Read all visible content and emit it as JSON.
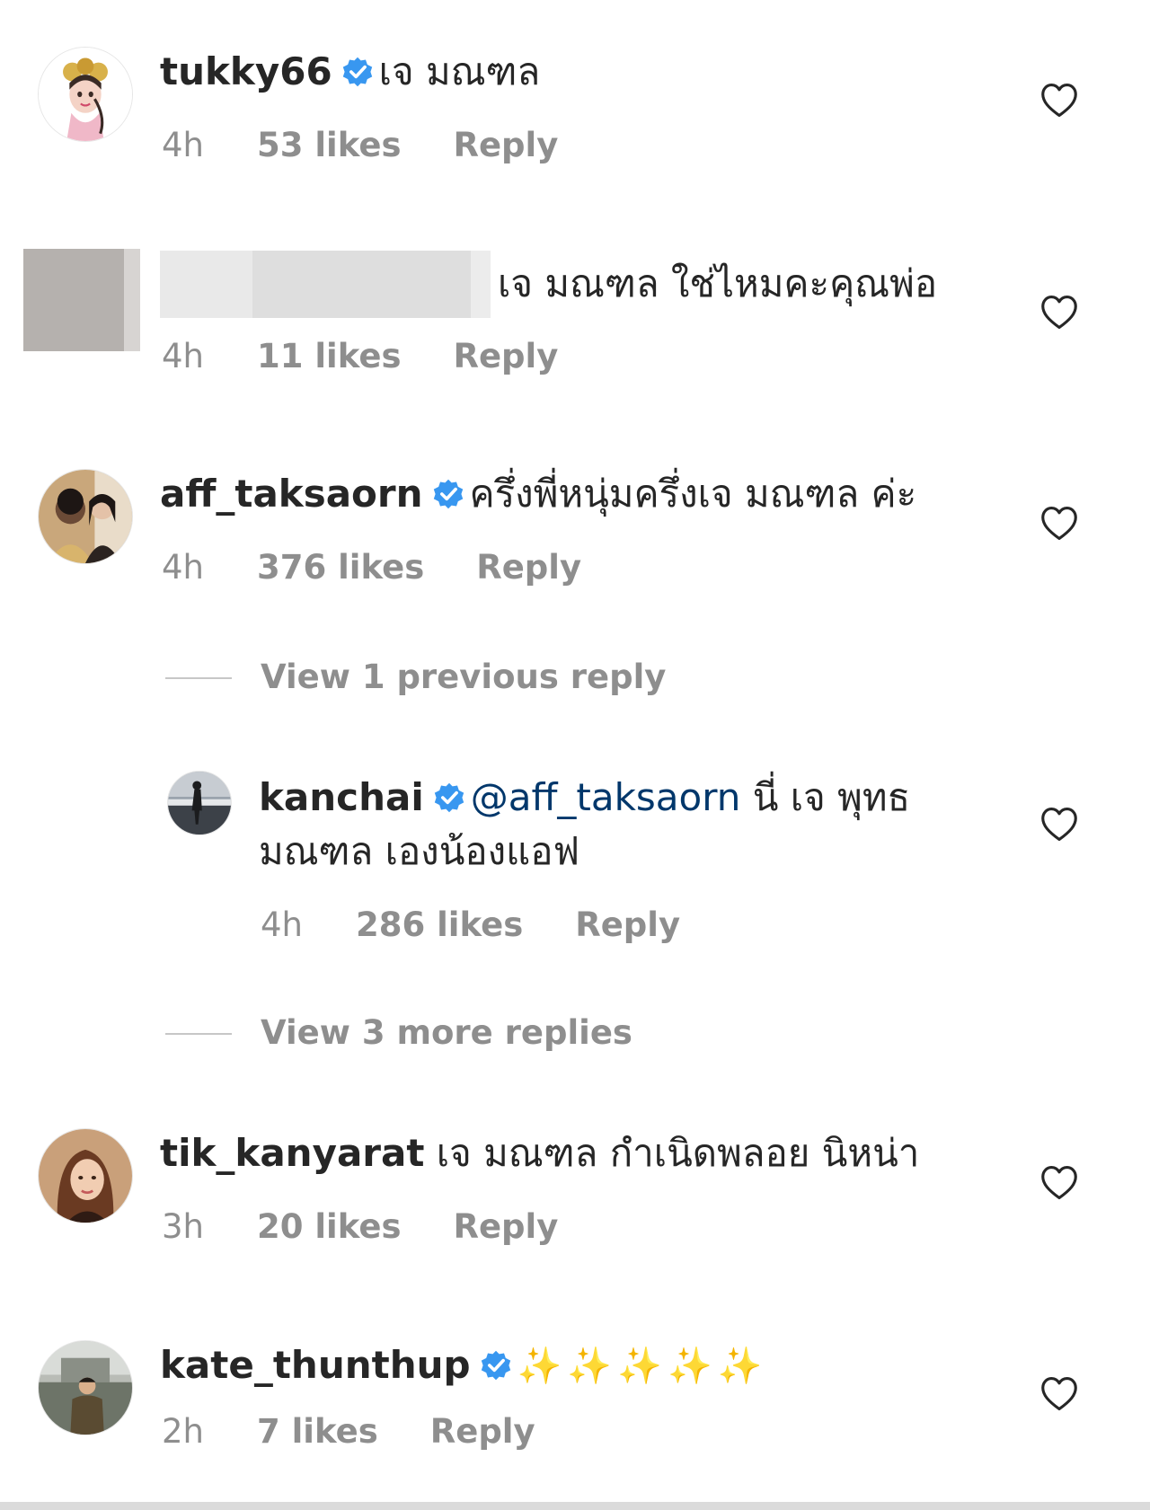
{
  "comments": [
    {
      "username": "tukky66",
      "verified": true,
      "text": "เจ มณฑล",
      "time": "4h",
      "likes": "53 likes",
      "reply": "Reply"
    },
    {
      "username": "",
      "verified": false,
      "text": "เจ มณฑล ใช่ไหมคะคุณพ่อ",
      "time": "4h",
      "likes": "11 likes",
      "reply": "Reply"
    },
    {
      "username": "aff_taksaorn",
      "verified": true,
      "text": "ครึ่งพี่หนุ่มครึ่งเจ มณฑล ค่ะ",
      "time": "4h",
      "likes": "376 likes",
      "reply": "Reply",
      "view_previous": "View 1 previous reply",
      "replies": [
        {
          "username": "kanchai",
          "verified": true,
          "mention": "@aff_taksaorn",
          "text_line1": "นี่ เจ พุทธ",
          "text_line2": "มณฑล เองน้องแอฟ",
          "time": "4h",
          "likes": "286 likes",
          "reply": "Reply"
        }
      ],
      "view_more": "View 3 more replies"
    },
    {
      "username": "tik_kanyarat",
      "verified": false,
      "text": "เจ มณฑล กำเนิดพลอย นิหน่า",
      "time": "3h",
      "likes": "20 likes",
      "reply": "Reply"
    },
    {
      "username": "kate_thunthup",
      "verified": true,
      "text": "✨✨✨✨✨",
      "time": "2h",
      "likes": "7 likes",
      "reply": "Reply"
    }
  ],
  "icons": {
    "verified": "verified-badge-icon",
    "like": "heart-outline-icon"
  },
  "colors": {
    "verified": "#3897f0",
    "meta_gray": "#8e8e8e",
    "text": "#262626",
    "mention": "#00376b"
  }
}
